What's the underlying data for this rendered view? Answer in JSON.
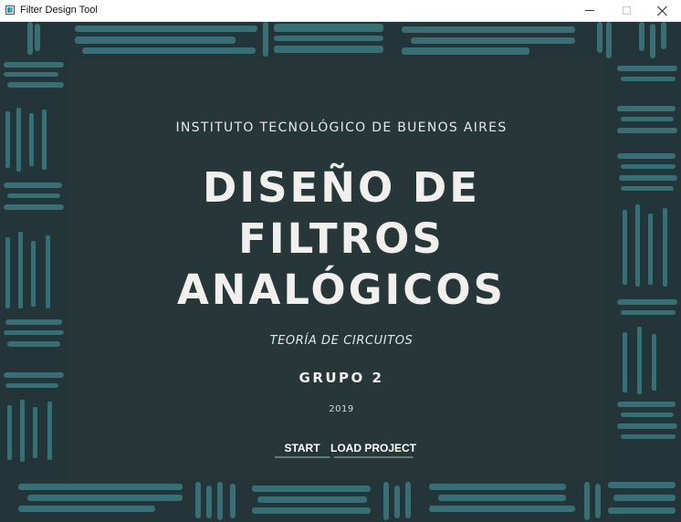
{
  "window": {
    "title": "Filter Design Tool",
    "controls": [
      "minimize-icon",
      "maximize-icon",
      "close-icon"
    ]
  },
  "content": {
    "institute": "INSTITUTO TECNOLÓGICO DE BUENOS AIRES",
    "title_lines": [
      "DISEÑO DE",
      "FILTROS",
      "ANALÓGICOS"
    ],
    "subject": "TEORÍA DE CIRCUITOS",
    "group": "GRUPO 2",
    "year": "2019"
  },
  "buttons": {
    "start": "START",
    "load_project": "LOAD PROJECT"
  },
  "colors": {
    "background_dark": "#263639",
    "pattern_teal": "#3a6e75",
    "text_light": "#f2f0ee"
  }
}
